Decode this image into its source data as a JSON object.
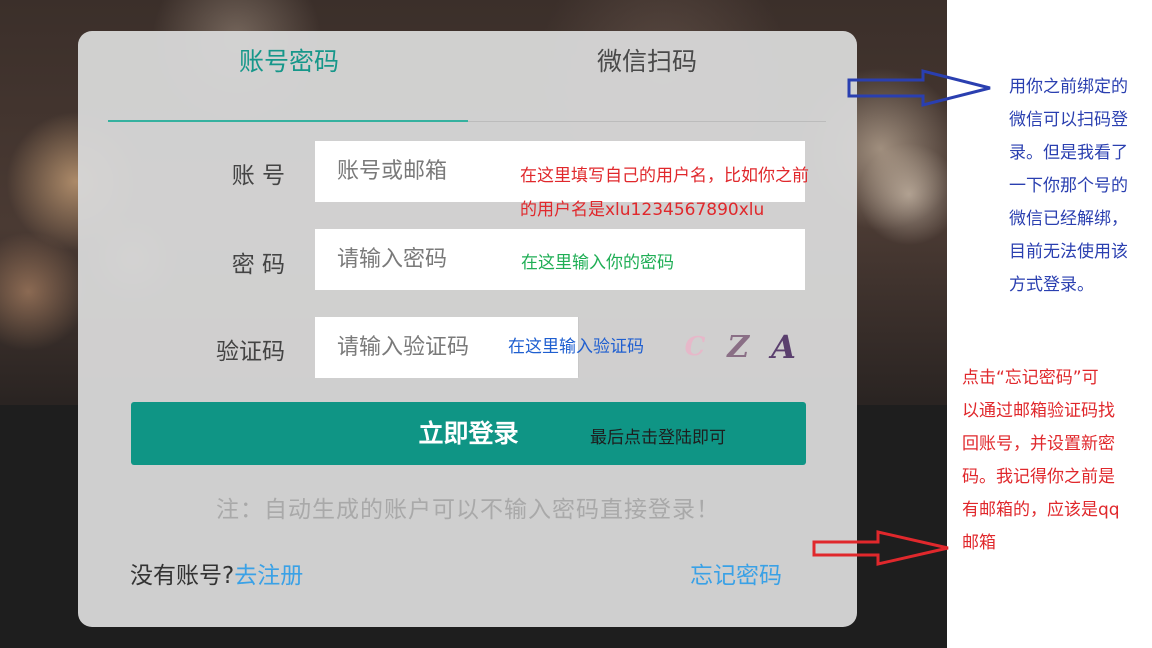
{
  "tabs": {
    "account": "账号密码",
    "wechat": "微信扫码"
  },
  "form": {
    "username_label": "账 号",
    "username_placeholder": "账号或邮箱",
    "password_label": "密 码",
    "password_placeholder": "请输入密码",
    "captcha_label": "验证码",
    "captcha_placeholder": "请输入验证码",
    "captcha_chars": [
      "C",
      "Z",
      "A"
    ]
  },
  "login_button": "立即登录",
  "note": "注：自动生成的账户可以不输入密码直接登录！",
  "footer": {
    "no_account": "没有账号?",
    "register": "去注册",
    "forgot": "忘记密码"
  },
  "annotations": {
    "username_line1": "在这里填写自己的用户名，比如你之前",
    "username_line2": "的用户名是xlu1234567890xlu",
    "password": "在这里输入你的密码",
    "captcha": "在这里输入验证码",
    "login": "最后点击登陆即可",
    "wechat_lines": [
      "用你之前绑定的",
      "微信可以扫码登",
      "录。但是我看了",
      "一下你那个号的",
      "微信已经解绑，",
      "目前无法使用该",
      "方式登录。"
    ],
    "forgot_lines": [
      "点击“忘记密码”可",
      "以通过邮箱验证码找",
      "回账号，并设置新密",
      "码。我记得你之前是",
      "有邮箱的，应该是qq",
      "邮箱"
    ]
  },
  "colors": {
    "accent": "#0f9585",
    "active_tab": "#16978a",
    "link": "#3aa1e6",
    "annotation_red": "#e0282c",
    "annotation_green": "#1fae55",
    "annotation_blue": "#1f5fd0",
    "annotation_arrow_blue": "#2a3fb0",
    "annotation_arrow_red": "#e0282c"
  }
}
